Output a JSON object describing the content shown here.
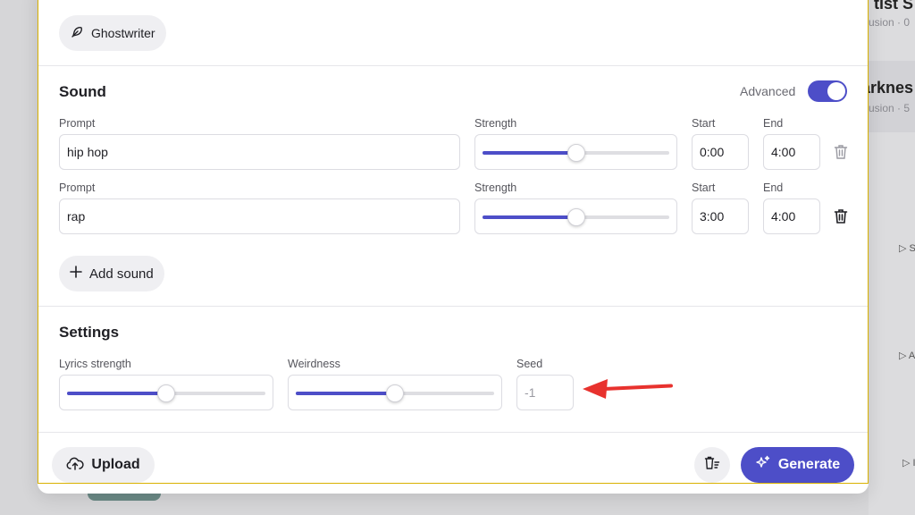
{
  "background": {
    "title_1": "tist S",
    "sub_1": "usion · 0",
    "title_2": "arknes",
    "sub_2": "usion · 5",
    "play_1": "▷ S",
    "play_2": "▷ A",
    "play_3": "▷ I"
  },
  "ghostwriter": {
    "label": "Ghostwriter",
    "icon": "feather-icon"
  },
  "sound": {
    "title": "Sound",
    "advanced_label": "Advanced",
    "advanced_on": true,
    "rows": [
      {
        "prompt_label": "Prompt",
        "prompt": "hip hop",
        "strength_label": "Strength",
        "strength": 0.5,
        "start_label": "Start",
        "start": "0:00",
        "end_label": "End",
        "end": "4:00"
      },
      {
        "prompt_label": "Prompt",
        "prompt": "rap",
        "strength_label": "Strength",
        "strength": 0.5,
        "start_label": "Start",
        "start": "3:00",
        "end_label": "End",
        "end": "4:00"
      }
    ],
    "add_sound_label": "Add sound"
  },
  "settings": {
    "title": "Settings",
    "lyrics_strength_label": "Lyrics strength",
    "lyrics_strength": 0.5,
    "weirdness_label": "Weirdness",
    "weirdness": 0.5,
    "seed_label": "Seed",
    "seed": "-1"
  },
  "footer": {
    "upload_label": "Upload",
    "generate_label": "Generate"
  },
  "colors": {
    "accent": "#4d4ec8",
    "annotation_arrow": "#e8322e"
  }
}
